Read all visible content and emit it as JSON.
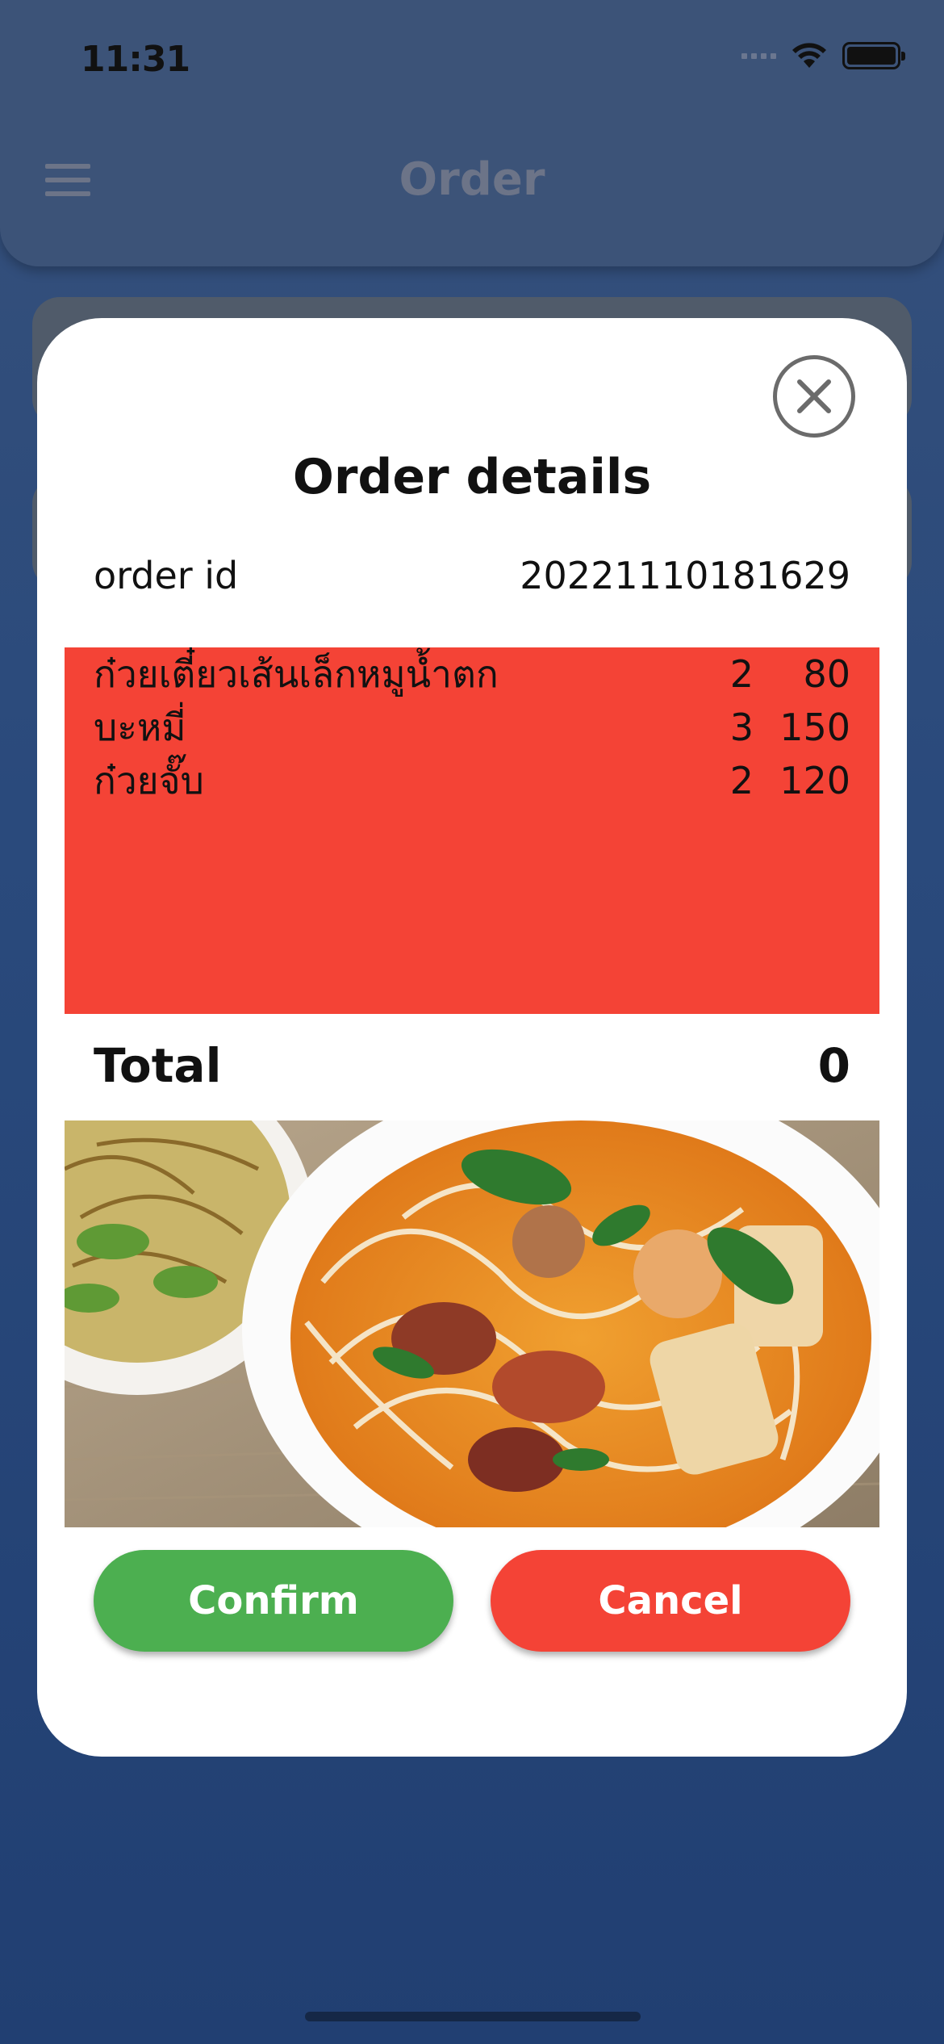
{
  "status_bar": {
    "time": "11:31"
  },
  "app_bar": {
    "title": "Order"
  },
  "modal": {
    "title": "Order details",
    "order_id_label": "order id",
    "order_id_value": "20221110181629",
    "items": [
      {
        "name": "ก๋วยเตี๋ยวเส้นเล็กหมูน้ำตก",
        "qty": "2",
        "price": "80"
      },
      {
        "name": "บะหมี่",
        "qty": "3",
        "price": "150"
      },
      {
        "name": "ก๋วยจั๊บ",
        "qty": "2",
        "price": "120"
      }
    ],
    "total_label": "Total",
    "total_value": "0",
    "confirm_label": "Confirm",
    "cancel_label": "Cancel"
  },
  "colors": {
    "items_panel": "#f44336",
    "confirm": "#4caf50",
    "cancel": "#f44336",
    "background": "#2a4a7c"
  },
  "icons": [
    "hamburger-menu-icon",
    "close-icon",
    "wifi-icon",
    "battery-icon"
  ]
}
